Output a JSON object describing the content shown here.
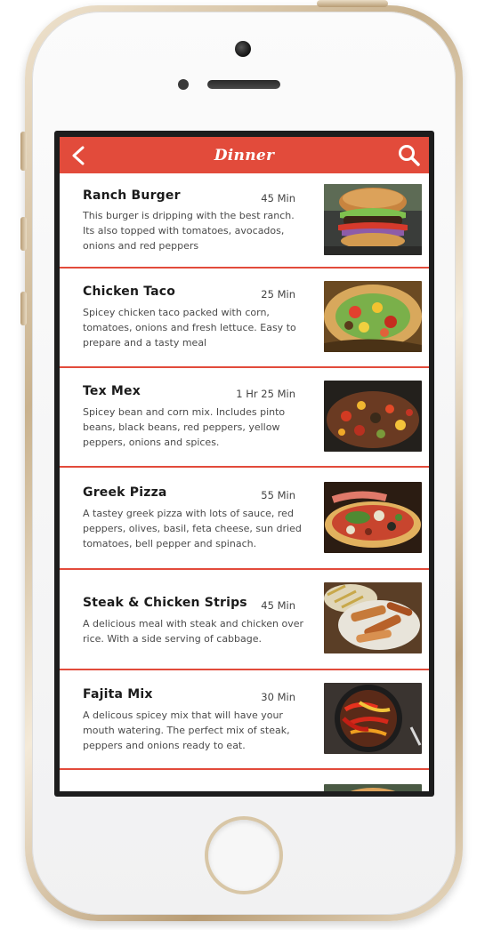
{
  "header": {
    "title": "Dinner",
    "back_icon": "chevron-left-icon",
    "search_icon": "search-icon",
    "accent_color": "#e24b3b"
  },
  "recipes": [
    {
      "title": "Ranch Burger",
      "time": "45 Min",
      "description": "This burger is dripping with the best ranch. Its also topped with tomatoes, avocados, onions and red peppers",
      "image": "burger-photo"
    },
    {
      "title": "Chicken Taco",
      "time": "25 Min",
      "description": "Spicey chicken taco packed with corn, tomatoes, onions and fresh lettuce. Easy to prepare and a tasty meal",
      "image": "taco-photo"
    },
    {
      "title": "Tex Mex",
      "time": "1 Hr 25 Min",
      "description": "Spicey bean and corn mix. Includes pinto beans, black beans, red peppers, yellow peppers, onions and spices.",
      "image": "tex-mex-photo"
    },
    {
      "title": "Greek Pizza",
      "time": "55 Min",
      "description": "A tastey greek pizza with lots of sauce, red peppers, olives, basil, feta cheese, sun dried tomatoes, bell pepper and spinach.",
      "image": "pizza-photo"
    },
    {
      "title": "Steak & Chicken Strips",
      "time": "45 Min",
      "description": "A delicious meal with steak and chicken over rice. With a side serving of cabbage.",
      "image": "steak-chicken-photo"
    },
    {
      "title": "Fajita Mix",
      "time": "30 Min",
      "description": "A delicous spicey mix that will have your mouth watering. The perfect mix of steak, peppers and onions ready to eat.",
      "image": "fajita-photo"
    }
  ]
}
